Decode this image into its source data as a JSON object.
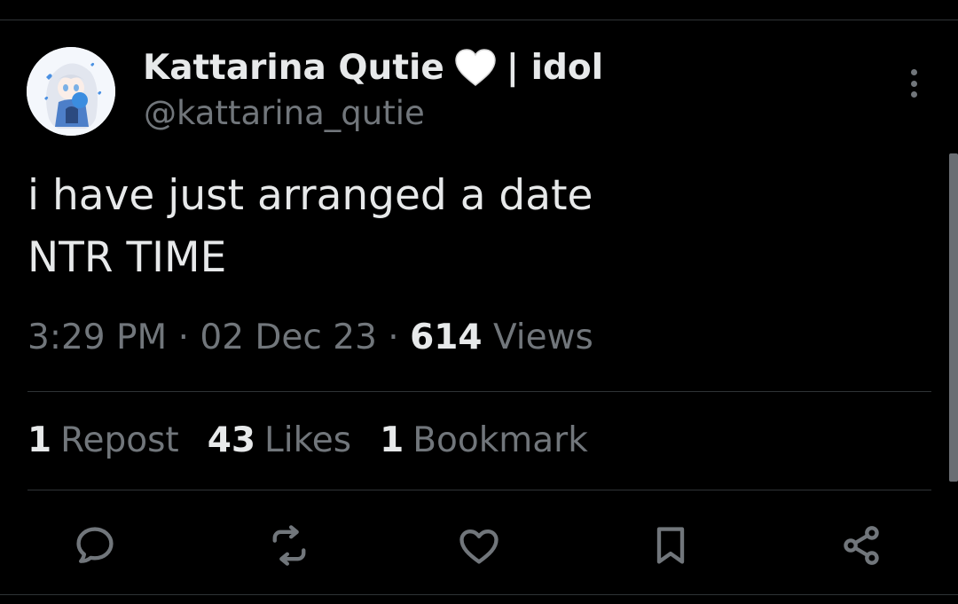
{
  "author": {
    "display_name": "Kattarina Qutie",
    "name_suffix": "| idol",
    "handle": "@kattarina_qutie",
    "avatar_icon": "anime-avatar",
    "badge_icon": "white-heart-icon"
  },
  "tweet": {
    "lines": [
      "i have just arranged a date",
      "NTR TIME"
    ]
  },
  "meta": {
    "time": "3:29 PM",
    "sep1": "·",
    "date": "02 Dec 23",
    "sep2": "·",
    "views_count": "614",
    "views_label": "Views"
  },
  "stats": {
    "reposts_count": "1",
    "reposts_label": "Repost",
    "likes_count": "43",
    "likes_label": "Likes",
    "bookmarks_count": "1",
    "bookmarks_label": "Bookmark"
  },
  "actions": [
    {
      "icon": "reply-icon"
    },
    {
      "icon": "retweet-icon"
    },
    {
      "icon": "like-heart-icon"
    },
    {
      "icon": "bookmark-icon"
    },
    {
      "icon": "share-icon"
    }
  ],
  "colors": {
    "background": "#000000",
    "text": "#e7e9ea",
    "secondary": "#71767b",
    "divider": "#2f3336"
  }
}
